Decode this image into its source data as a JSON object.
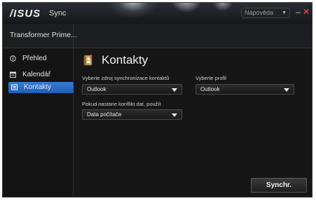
{
  "window": {
    "logo": "/ISUS",
    "app_name": "Sync",
    "help_label": "Nápověda",
    "minimize_glyph": "–",
    "close_glyph": "×"
  },
  "device": {
    "name": "Transformer Prime..."
  },
  "sidebar": {
    "items": [
      {
        "label": "Přehled",
        "icon": "info-icon",
        "active": false
      },
      {
        "label": "Kalendář",
        "icon": "calendar-icon",
        "active": false
      },
      {
        "label": "Kontakty",
        "icon": "contacts-icon",
        "active": true
      }
    ]
  },
  "main": {
    "title": "Kontakty",
    "source": {
      "label": "Vyberte zdroj synchronizace kontaktů",
      "value": "Outlook"
    },
    "profile": {
      "label": "Vyberte profil",
      "value": "Outlook"
    },
    "conflict": {
      "label": "Pokud nastane konflikt dat, použít",
      "value": "Data počítače"
    },
    "sync_button": "Synchr."
  },
  "colors": {
    "accent": "#2566bf",
    "background": "#161616",
    "titlebar": "#1c1e22"
  }
}
